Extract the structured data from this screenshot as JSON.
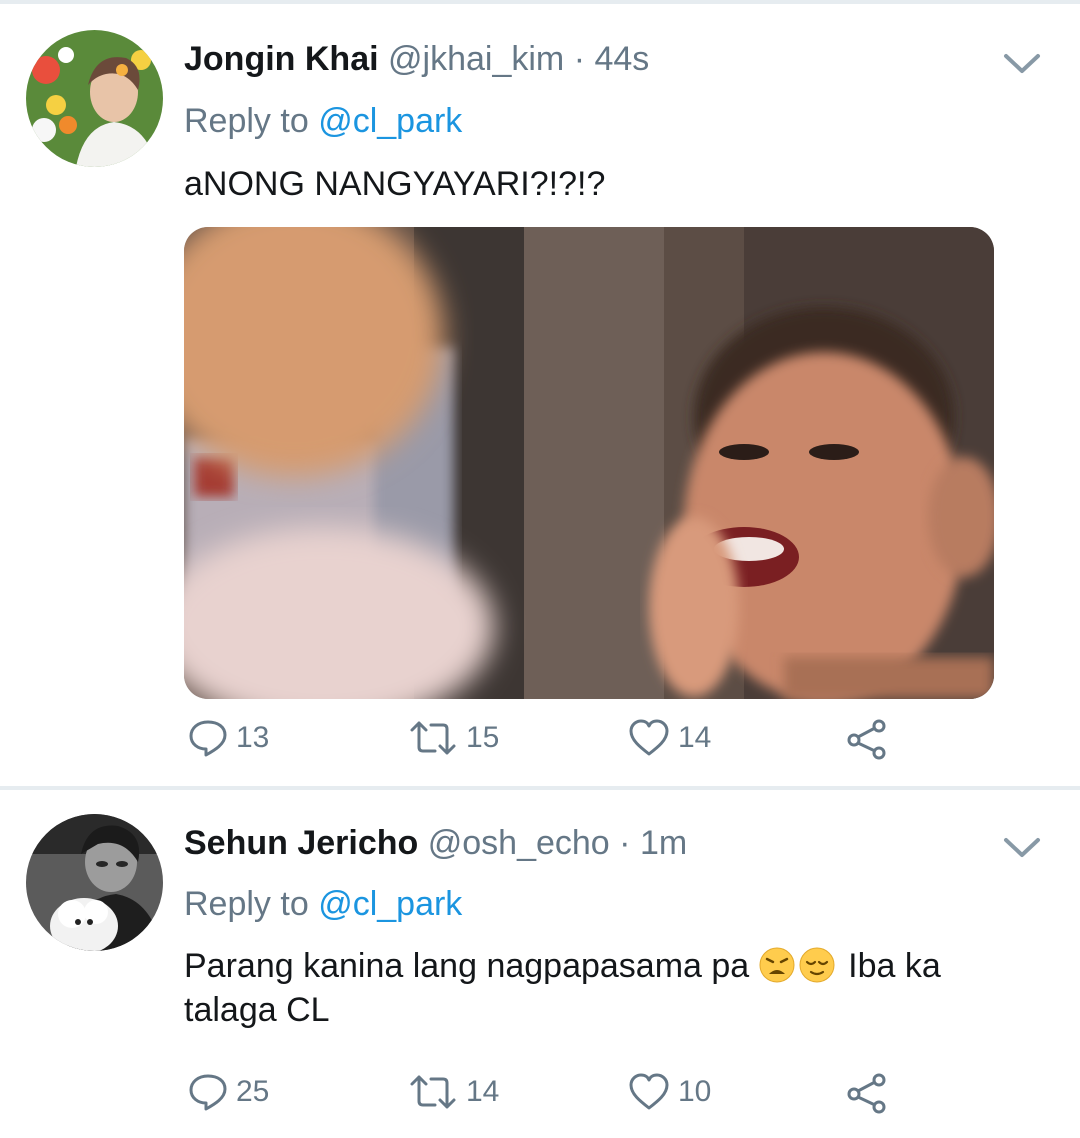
{
  "tweets": [
    {
      "name": "Jongin Khai",
      "handle": "@jkhai_kim",
      "separator": "·",
      "time": "44s",
      "reply_prefix": "Reply to",
      "reply_to": "@cl_park",
      "text": "aNONG NANGYAYARI?!?!?",
      "counts": {
        "replies": "13",
        "retweets": "15",
        "likes": "14"
      }
    },
    {
      "name": "Sehun Jericho",
      "handle": "@osh_echo",
      "separator": "·",
      "time": "1m",
      "reply_prefix": "Reply to",
      "reply_to": "@cl_park",
      "text_before": "Parang kanina lang nagpapasama pa",
      "text_after": "Iba ka talaga CL",
      "emojis": [
        "weary-face-emoji",
        "relieved-face-emoji"
      ],
      "counts": {
        "replies": "25",
        "retweets": "14",
        "likes": "10"
      }
    }
  ],
  "colors": {
    "name": "#14171a",
    "secondary": "#657786",
    "mention": "#1b95e0",
    "divider": "#e6ecf0",
    "icon": "#657786"
  },
  "icons": [
    "chevron-down-icon",
    "reply-icon",
    "retweet-icon",
    "like-icon",
    "share-icon"
  ]
}
